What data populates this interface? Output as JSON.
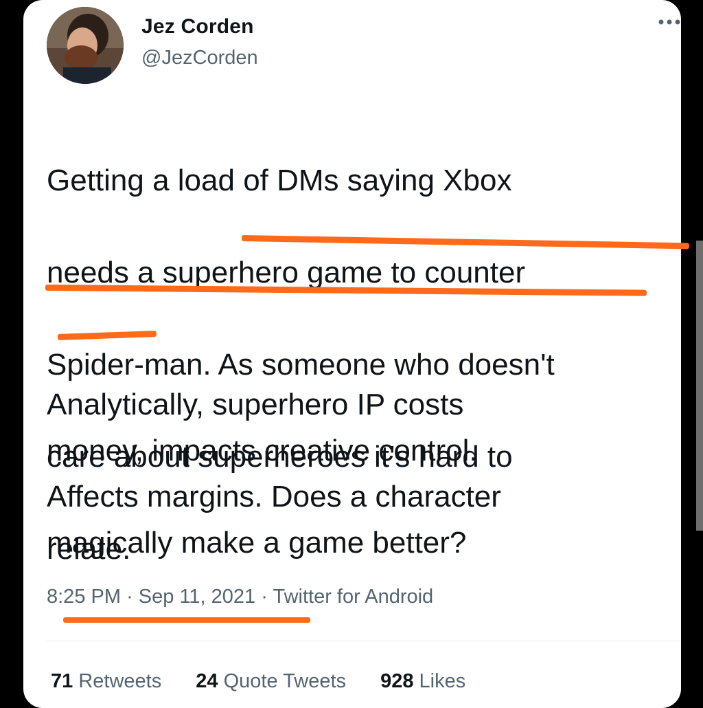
{
  "tweet": {
    "author": {
      "display_name": "Jez Corden",
      "handle": "@JezCorden"
    },
    "text_lines_1": [
      "Getting a load of DMs saying Xbox",
      "needs a superhero game to counter",
      "Spider-man. As someone who doesn't",
      "care about superheroes it's hard to",
      "relate."
    ],
    "text_lines_2": [
      "Analytically, superhero IP costs",
      "money, impacts creative control.",
      "Affects margins. Does a character",
      "magically make a game better?"
    ],
    "meta": {
      "time": "8:25 PM",
      "separator": "·",
      "date": "Sep 11, 2021",
      "source": "Twitter for Android"
    },
    "stats": {
      "retweets_count": "71",
      "retweets_label": "Retweets",
      "quotes_count": "24",
      "quotes_label": "Quote Tweets",
      "likes_count": "928",
      "likes_label": "Likes"
    }
  },
  "icons": {
    "more": "more-options-icon",
    "avatar": "avatar"
  },
  "colors": {
    "highlight": "#ff6a1a",
    "text": "#0f1419",
    "secondary": "#536471",
    "background": "#000000",
    "card": "#ffffff"
  }
}
